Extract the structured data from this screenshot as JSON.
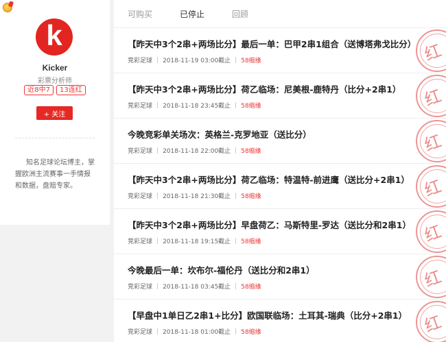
{
  "profile": {
    "avatar_letter": "k",
    "name": "Kicker",
    "role": "彩票分析师",
    "tags": [
      "近8中7",
      "13连红"
    ],
    "follow_label": "+ 关注",
    "bio": "知名足球论坛博主，掌握欧洲主流赛事一手情报和数据，盘赔专家。"
  },
  "tabs": [
    "可购买",
    "已停止",
    "回顾"
  ],
  "active_tab": "已停止",
  "stamp_text": "红",
  "items": [
    {
      "title": "【昨天中3个2串+两场比分】最后一单：巴甲2串1组合（送博塔弗戈比分）",
      "category": "竞彩足球",
      "deadline": "2018-11-19 03:00截止",
      "count": "58缩缘"
    },
    {
      "title": "【昨天中3个2串+两场比分】荷乙临场：尼美根-鹿特丹（比分+2串1）",
      "category": "竞彩足球",
      "deadline": "2018-11-18 23:45截止",
      "count": "58缩缘"
    },
    {
      "title": "今晚竞彩单关场次：英格兰-克罗地亚（送比分）",
      "category": "竞彩足球",
      "deadline": "2018-11-18 22:00截止",
      "count": "58缩缘"
    },
    {
      "title": "【昨天中3个2串+两场比分】荷乙临场：特温特-前进鹰（送比分+2串1）",
      "category": "竞彩足球",
      "deadline": "2018-11-18 21:30截止",
      "count": "58缩缘"
    },
    {
      "title": "【昨天中3个2串+两场比分】早盘荷乙：马斯特里-罗达（送比分和2串1）",
      "category": "竞彩足球",
      "deadline": "2018-11-18 19:15截止",
      "count": "58缩缘"
    },
    {
      "title": "今晚最后一单：坎布尔-福伦丹（送比分和2串1）",
      "category": "竞彩足球",
      "deadline": "2018-11-18 03:45截止",
      "count": "58缩缘"
    },
    {
      "title": "【早盘中1单日乙2串1+比分】欧国联临场：土耳其-瑞典（比分+2串1）",
      "category": "竞彩足球",
      "deadline": "2018-11-18 01:00截止",
      "count": "58缩缘"
    }
  ],
  "colors": {
    "accent": "#e62925",
    "stamp": "#dc3c3c"
  }
}
